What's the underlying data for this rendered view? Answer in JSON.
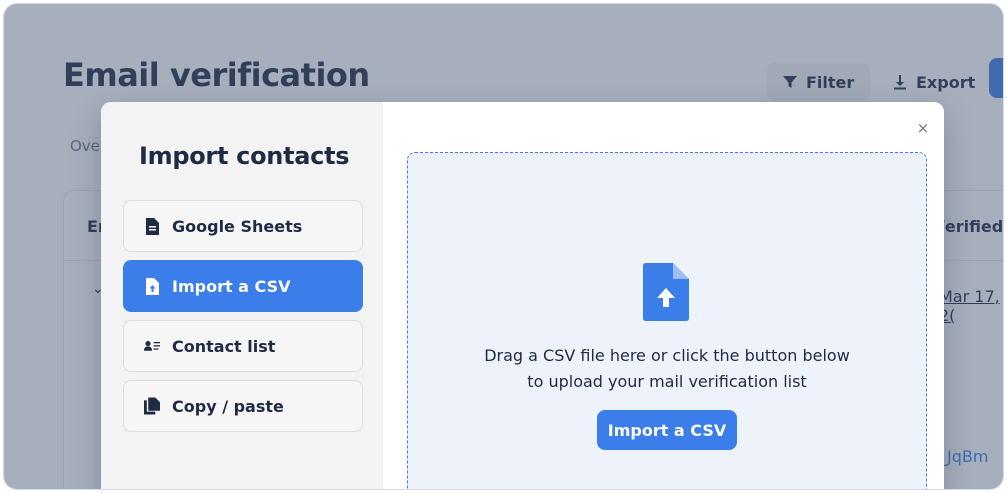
{
  "page": {
    "title": "Email verification",
    "toolbar": {
      "filter_label": "Filter",
      "export_label": "Export"
    },
    "tab_fragment": "Ove",
    "table": {
      "col_fragment_left": "Er",
      "col_fragment_right": "/erified",
      "row_chevron": "⌄",
      "date_fragment": "Mar 17, 2(",
      "link_fragment": "_JqBm"
    }
  },
  "modal": {
    "heading": "Import contacts",
    "close_glyph": "×",
    "options": [
      {
        "label": "Google Sheets",
        "icon": "document-icon",
        "active": false
      },
      {
        "label": "Import a CSV",
        "icon": "file-upload-icon",
        "active": true
      },
      {
        "label": "Contact list",
        "icon": "contact-list-icon",
        "active": false
      },
      {
        "label": "Copy / paste",
        "icon": "copy-icon",
        "active": false
      }
    ],
    "dropzone": {
      "icon": "file-upload-icon",
      "line1": "Drag a CSV file here or click the button below",
      "line2": "to upload your mail verification list",
      "button_label": "Import a CSV"
    }
  },
  "colors": {
    "accent": "#3b7de9",
    "text": "#1f2a44",
    "overlay": "rgba(72,88,118,0.48)",
    "dropzone_bg": "#eef2fb"
  }
}
